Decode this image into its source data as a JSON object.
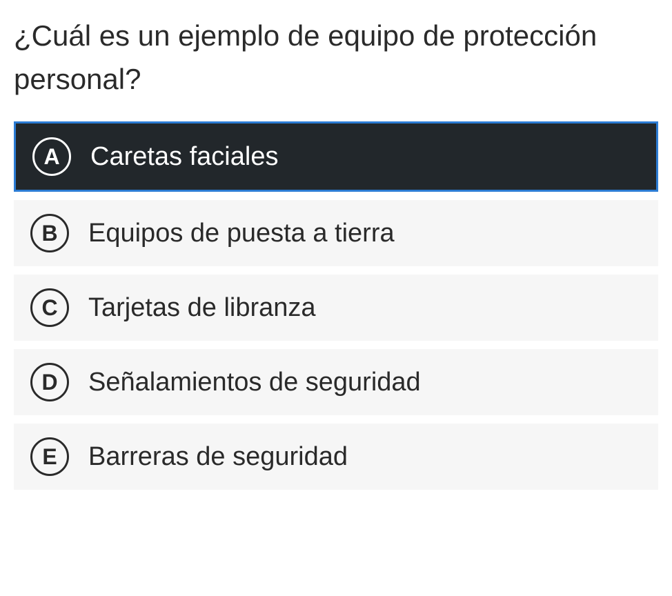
{
  "question": "¿Cuál es un ejemplo de equipo de protección personal?",
  "options": [
    {
      "letter": "A",
      "text": "Caretas faciales",
      "selected": true
    },
    {
      "letter": "B",
      "text": "Equipos de puesta a tierra",
      "selected": false
    },
    {
      "letter": "C",
      "text": "Tarjetas de libranza",
      "selected": false
    },
    {
      "letter": "D",
      "text": "Señalamientos de seguridad",
      "selected": false
    },
    {
      "letter": "E",
      "text": "Barreras de seguridad",
      "selected": false
    }
  ]
}
